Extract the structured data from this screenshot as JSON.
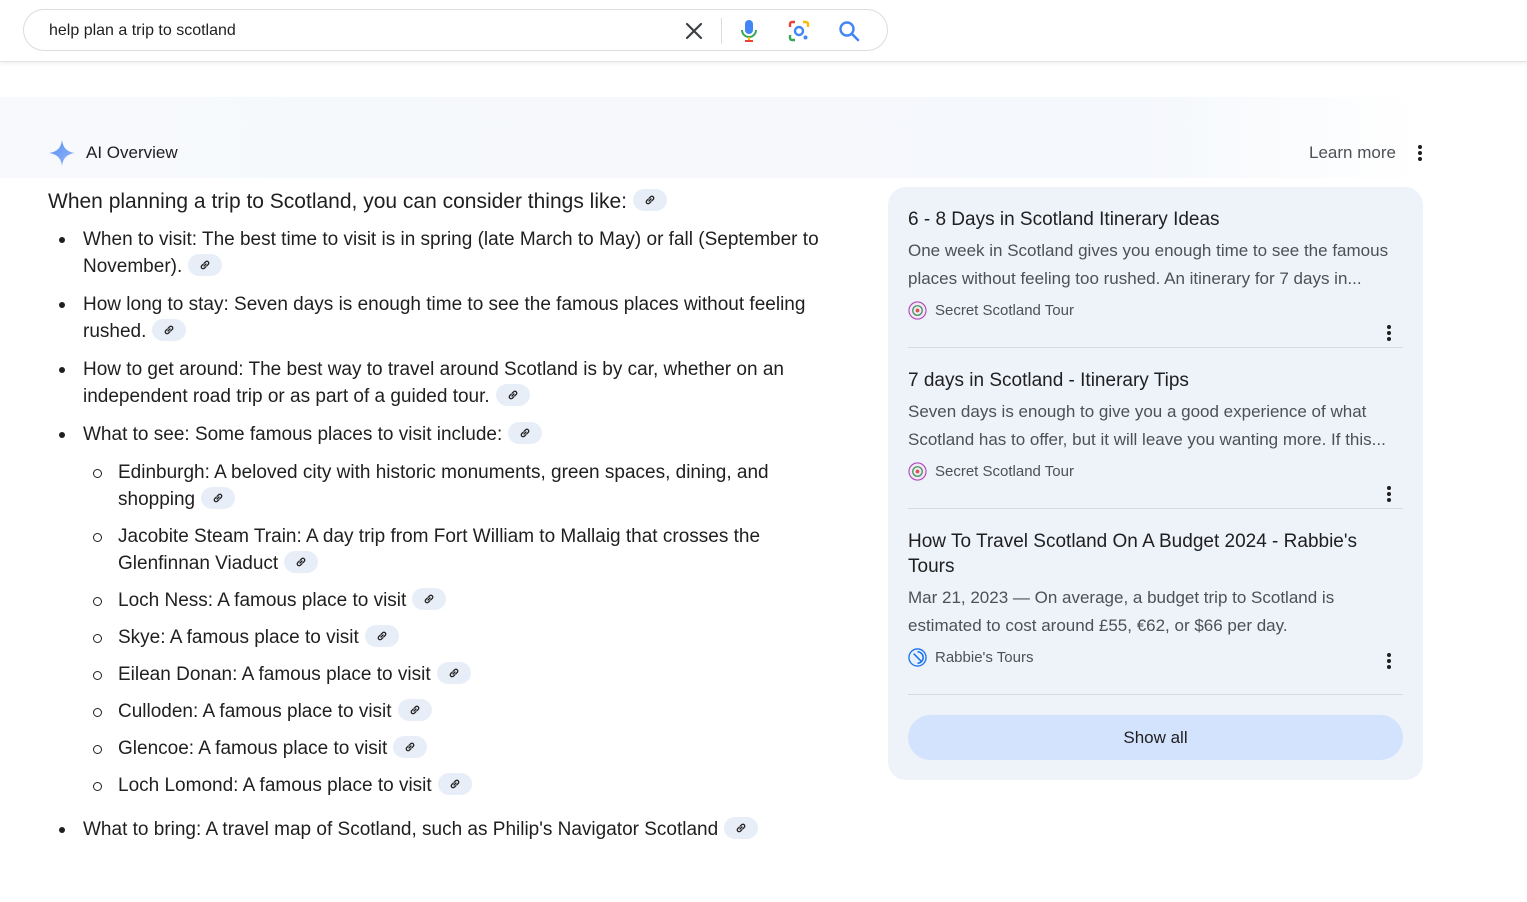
{
  "search": {
    "query": "help plan a trip to scotland",
    "icons": [
      "close-icon",
      "microphone-icon",
      "lens-icon",
      "search-icon"
    ]
  },
  "ai_overview": {
    "title": "AI Overview",
    "learn_more": "Learn more",
    "intro": "When planning a trip to Scotland, you can consider things like:",
    "items": [
      {
        "text": "When to visit: The best time to visit is in spring (late March to May) or fall (September to November)."
      },
      {
        "text": "How long to stay: Seven days is enough time to see the famous places without feeling rushed."
      },
      {
        "text": "How to get around: The best way to travel around Scotland is by car, whether on an independent road trip or as part of a guided tour."
      },
      {
        "text": "What to see: Some famous places to visit include:"
      },
      {
        "text": "What to bring: A travel map of Scotland, such as Philip's Navigator Scotland"
      }
    ],
    "places": [
      "Edinburgh: A beloved city with historic monuments, green spaces, dining, and shopping",
      "Jacobite Steam Train: A day trip from Fort William to Mallaig that crosses the Glenfinnan Viaduct",
      "Loch Ness: A famous place to visit",
      "Skye: A famous place to visit",
      "Eilean Donan: A famous place to visit",
      "Culloden: A famous place to visit",
      "Glencoe: A famous place to visit",
      "Loch Lomond: A famous place to visit"
    ]
  },
  "sources": {
    "items": [
      {
        "title": "6 - 8 Days in Scotland Itinerary Ideas",
        "snippet": "One week in Scotland gives you enough time to see the famous places without feeling too rushed. An itinerary for 7 days in...",
        "site": "Secret Scotland Tour"
      },
      {
        "title": "7 days in Scotland - Itinerary Tips",
        "snippet": "Seven days is enough to give you a good experience of what Scotland has to offer, but it will leave you wanting more. If this...",
        "site": "Secret Scotland Tour"
      },
      {
        "title": "How To Travel Scotland On A Budget 2024 - Rabbie's Tours",
        "snippet": "Mar 21, 2023 — On average, a budget trip to Scotland is estimated to cost around £55, €62, or $66 per day.",
        "site": "Rabbie's Tours"
      }
    ],
    "show_all": "Show all"
  },
  "colors": {
    "accent_blue": "#4285f4",
    "chip_bg": "#e8eef8",
    "card_bg": "#eef3fa",
    "show_all_bg": "#d3e3fd"
  }
}
